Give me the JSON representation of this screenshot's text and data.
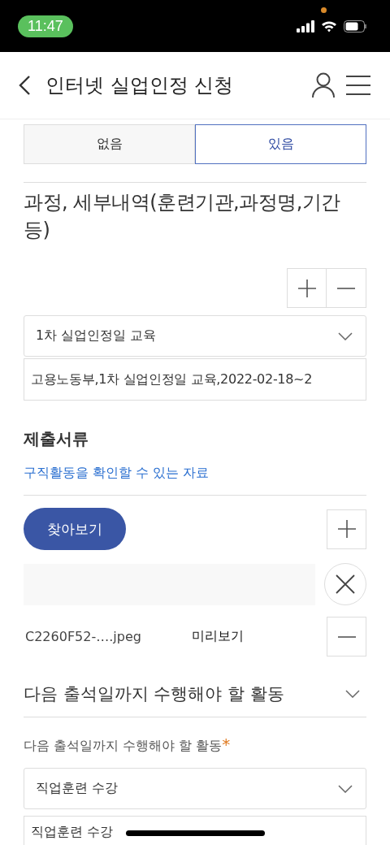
{
  "status_bar": {
    "time": "11:47"
  },
  "header": {
    "title": "인터넷 실업인정 신청"
  },
  "choice_tabs": [
    {
      "label": "없음",
      "selected": false
    },
    {
      "label": "있음",
      "selected": true
    }
  ],
  "course_section": {
    "title": "과정, 세부내역(훈련기관,과정명,기간 등)",
    "select": {
      "value": "1차 실업인정일 교육"
    },
    "detail_field": {
      "value": "고용노동부,1차 실업인정일 교육,2022-02-18~2"
    }
  },
  "documents": {
    "title": "제출서류",
    "link": "구직활동을 확인할 수 있는 자료",
    "browse_button": "찾아보기",
    "file": {
      "name": "C2260F52-….jpeg",
      "preview": "미리보기"
    }
  },
  "activity_section": {
    "title": "다음 출석일까지 수행해야 할 활동",
    "label": "다음 출석일까지 수행해야 할 활동",
    "required_mark": "*",
    "select": {
      "value": "직업훈련 수강"
    },
    "detail_field": {
      "value": "직업훈련 수강"
    }
  }
}
